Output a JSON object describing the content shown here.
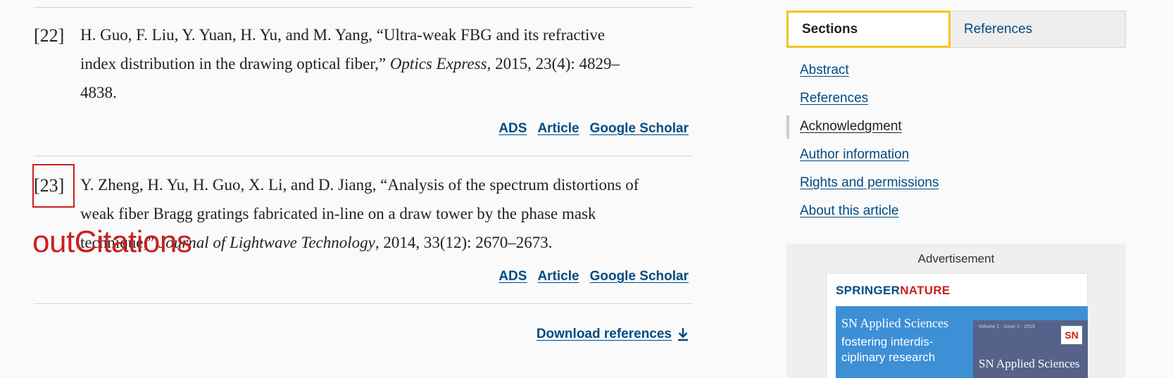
{
  "references": [
    {
      "number": "[22]",
      "line1": "H. Guo, F. Liu, Y. Yuan, H. Yu, and M. Yang, “Ultra-weak FBG and its refractive",
      "line2_pre": "index distribution in the drawing optical fiber,” ",
      "journal": "Optics Express",
      "line2_post": ", 2015, 23(4): 4829–",
      "line3": "4838.",
      "links": [
        "ADS",
        "Article",
        "Google Scholar"
      ]
    },
    {
      "number": "[23]",
      "line1": "Y. Zheng, H. Yu, H. Guo, X. Li, and D. Jiang, “Analysis of the spectrum distortions of",
      "line2": "weak fiber Bragg gratings fabricated in-line on a draw tower by the phase mask",
      "line3_pre": "technique,” ",
      "journal": "Journal of Lightwave Technology",
      "line3_post": ", 2014, 33(12): 2670–2673.",
      "links": [
        "ADS",
        "Article",
        "Google Scholar"
      ]
    }
  ],
  "overlay_label": "outCitations",
  "download_label": "Download references",
  "tabs": {
    "active": "Sections",
    "inactive": "References"
  },
  "section_nav": [
    "Abstract",
    "References",
    "Acknowledgment",
    "Author information",
    "Rights and permissions",
    "About this article"
  ],
  "ad": {
    "label": "Advertisement",
    "brand_part1": "SPRINGER",
    "brand_part2": "NATURE",
    "headline": "SN Applied Sciences",
    "tagline": "fostering interdis-ciplinary research",
    "cover_small": "Volume 1 · Issue 1 · 2019",
    "cover_badge": "SN",
    "cover_title": "SN Applied Sciences"
  },
  "colors": {
    "link": "#004b83",
    "highlight": "#cc1f1f",
    "tab_active_border": "#f5c518",
    "ad_blue": "#3d8fd6"
  }
}
